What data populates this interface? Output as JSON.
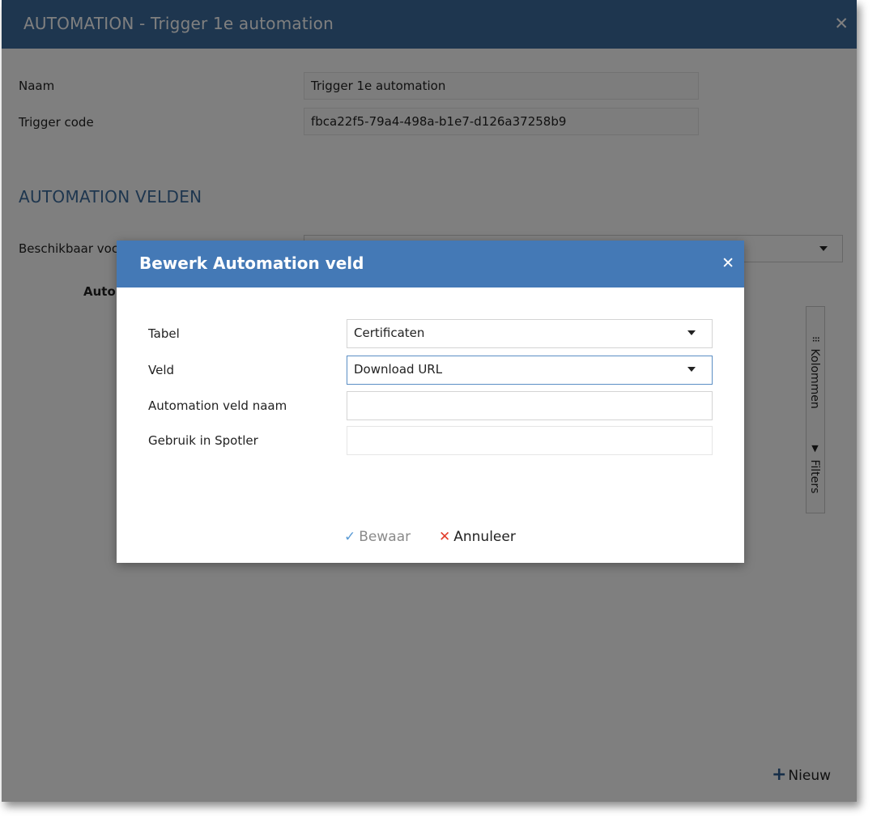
{
  "window": {
    "title": "AUTOMATION - Trigger 1e automation",
    "close_icon": "✕"
  },
  "form": {
    "naam_label": "Naam",
    "naam_value": "Trigger 1e automation",
    "trigger_code_label": "Trigger code",
    "trigger_code_value": "fbca22f5-79a4-498a-b1e7-d126a37258b9"
  },
  "section": {
    "title": "AUTOMATION VELDEN",
    "beschikbaar_label": "Beschikbaar voc",
    "grid_title": "Autor"
  },
  "side_panel": {
    "columns_label": "Kolommen",
    "columns_icon": "grid-icon",
    "filters_label": "Filters",
    "filters_icon": "filter-icon"
  },
  "footer": {
    "new_label": "Nieuw"
  },
  "modal": {
    "title": "Bewerk Automation veld",
    "fields": {
      "tabel_label": "Tabel",
      "tabel_value": "Certificaten",
      "veld_label": "Veld",
      "veld_value": "Download URL",
      "veld_naam_label": "Automation veld naam",
      "veld_naam_value": "",
      "spotler_label": "Gebruik in Spotler",
      "spotler_value": ""
    },
    "save_label": "Bewaar",
    "cancel_label": "Annuleer"
  },
  "colors": {
    "outer_header": "#3d6d9e",
    "modal_header": "#4479b6",
    "accent_blue": "#5b9bd5",
    "cancel_red": "#e23c2a"
  }
}
